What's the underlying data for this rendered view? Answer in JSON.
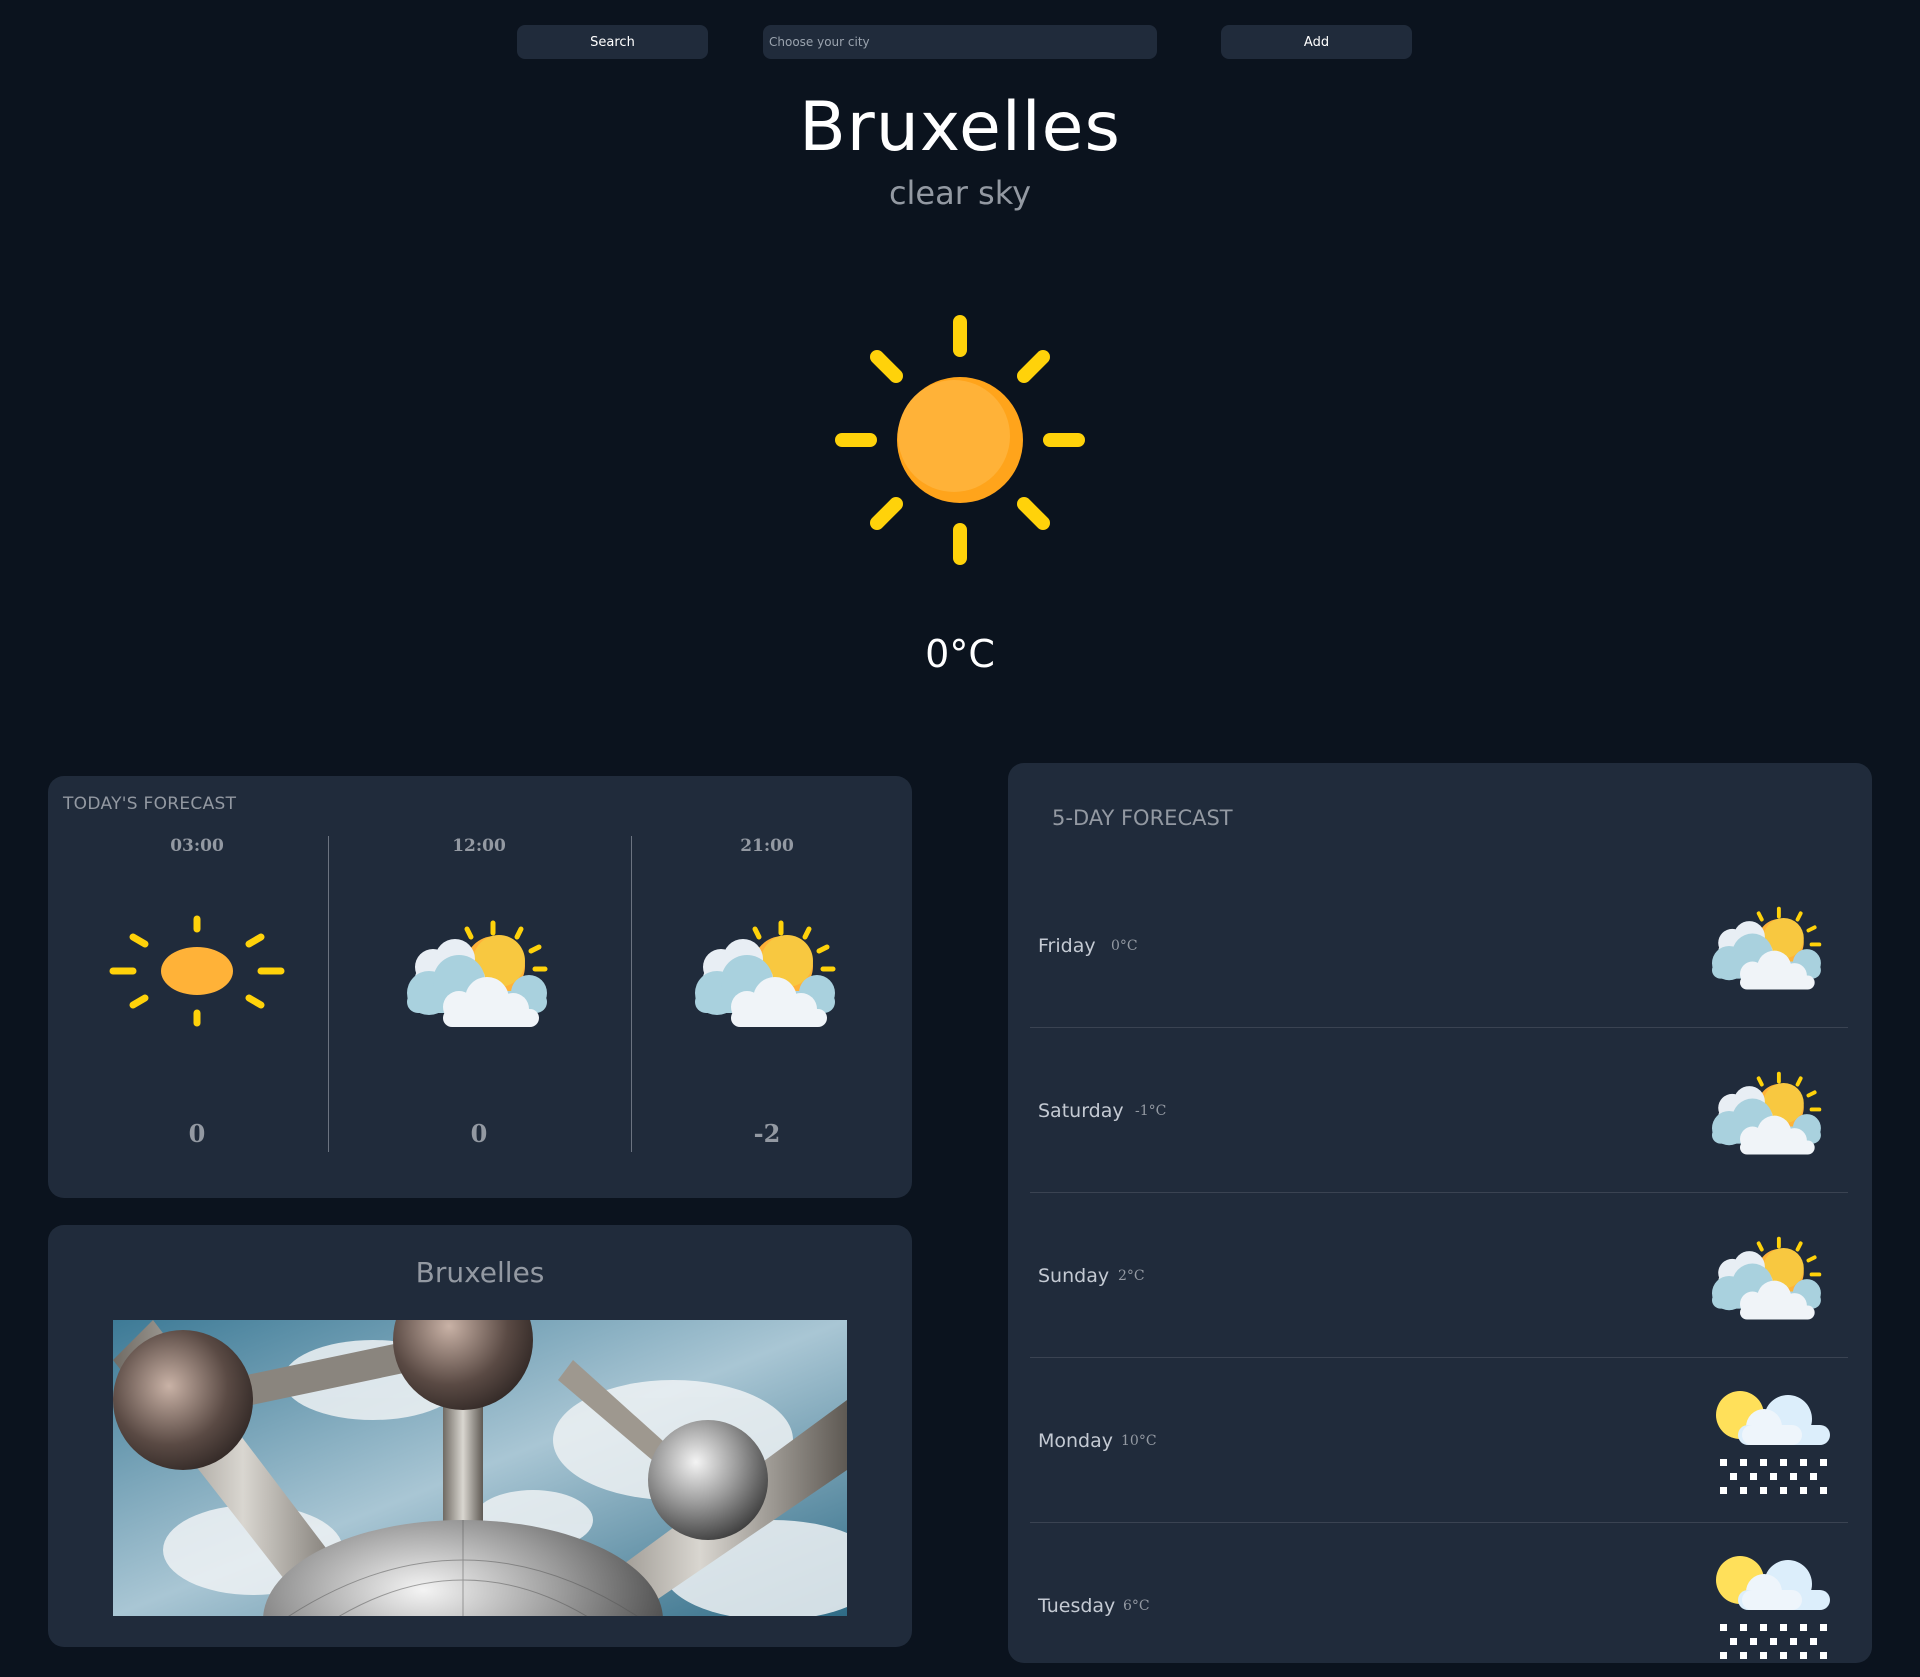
{
  "topbar": {
    "search_label": "Search",
    "city_placeholder": "Choose your city",
    "add_label": "Add"
  },
  "current": {
    "city": "Bruxelles",
    "description": "clear sky",
    "temperature": "0°C",
    "icon": "sun-icon"
  },
  "today": {
    "title": "TODAY'S FORECAST",
    "hours": [
      {
        "time": "03:00",
        "value": "0",
        "icon": "sun-icon"
      },
      {
        "time": "12:00",
        "value": "0",
        "icon": "partly-cloudy-icon"
      },
      {
        "time": "21:00",
        "value": "-2",
        "icon": "partly-cloudy-icon"
      }
    ]
  },
  "photo": {
    "title": "Bruxelles",
    "image": "atomium-photo"
  },
  "forecast": {
    "title": "5-DAY FORECAST",
    "days": [
      {
        "day": "Friday",
        "temp": "0°C",
        "icon": "partly-cloudy-icon"
      },
      {
        "day": "Saturday",
        "temp": "-1°C",
        "icon": "partly-cloudy-icon"
      },
      {
        "day": "Sunday",
        "temp": "2°C",
        "icon": "partly-cloudy-icon"
      },
      {
        "day": "Monday",
        "temp": "10°C",
        "icon": "snow-icon"
      },
      {
        "day": "Tuesday",
        "temp": "6°C",
        "icon": "snow-icon"
      }
    ]
  },
  "colors": {
    "background": "#0b131e",
    "card": "#202b3b",
    "muted_text": "#9399a2",
    "sun": "#ffb238",
    "sun_rays": "#ffd20a"
  }
}
